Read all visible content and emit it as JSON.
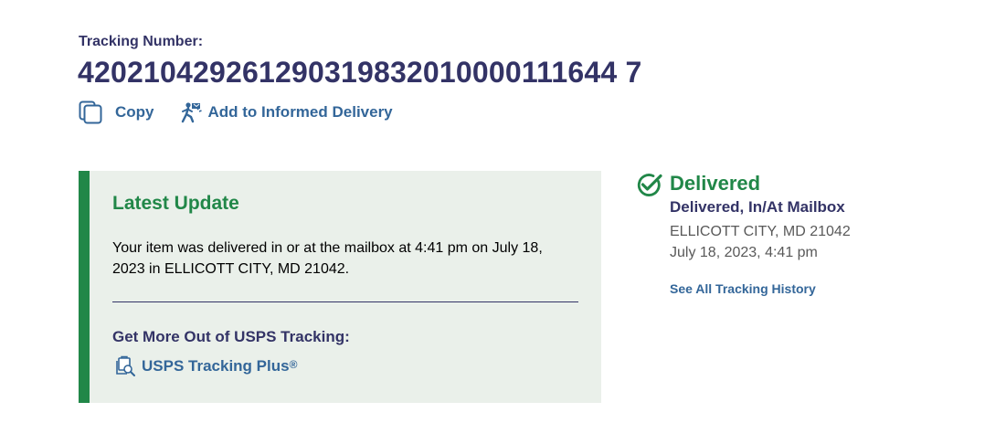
{
  "tracking": {
    "label": "Tracking Number:",
    "number": "420210429261290319832010000111644 7"
  },
  "actions": {
    "copy": {
      "label": "Copy",
      "icon": "copy-icon"
    },
    "informed_delivery": {
      "label": "Add to Informed Delivery",
      "icon": "mail-carrier-icon"
    }
  },
  "latest_update": {
    "title": "Latest Update",
    "message": "Your item was delivered in or at the mailbox at 4:41 pm on July 18, 2023 in ELLICOTT CITY, MD 21042.",
    "more_title": "Get More Out of USPS Tracking:",
    "plus_link": {
      "label": "USPS Tracking Plus",
      "mark": "®",
      "icon": "tracking-plus-icon"
    }
  },
  "status": {
    "icon": "check-circle-icon",
    "title": "Delivered",
    "subtitle": "Delivered, In/At Mailbox",
    "location": "ELLICOTT CITY, MD 21042",
    "datetime": "July 18, 2023, 4:41 pm",
    "history_link": "See All Tracking History"
  },
  "colors": {
    "navy": "#333366",
    "link_blue": "#336699",
    "green": "#218748",
    "panel_bg": "#eaf0ea"
  }
}
